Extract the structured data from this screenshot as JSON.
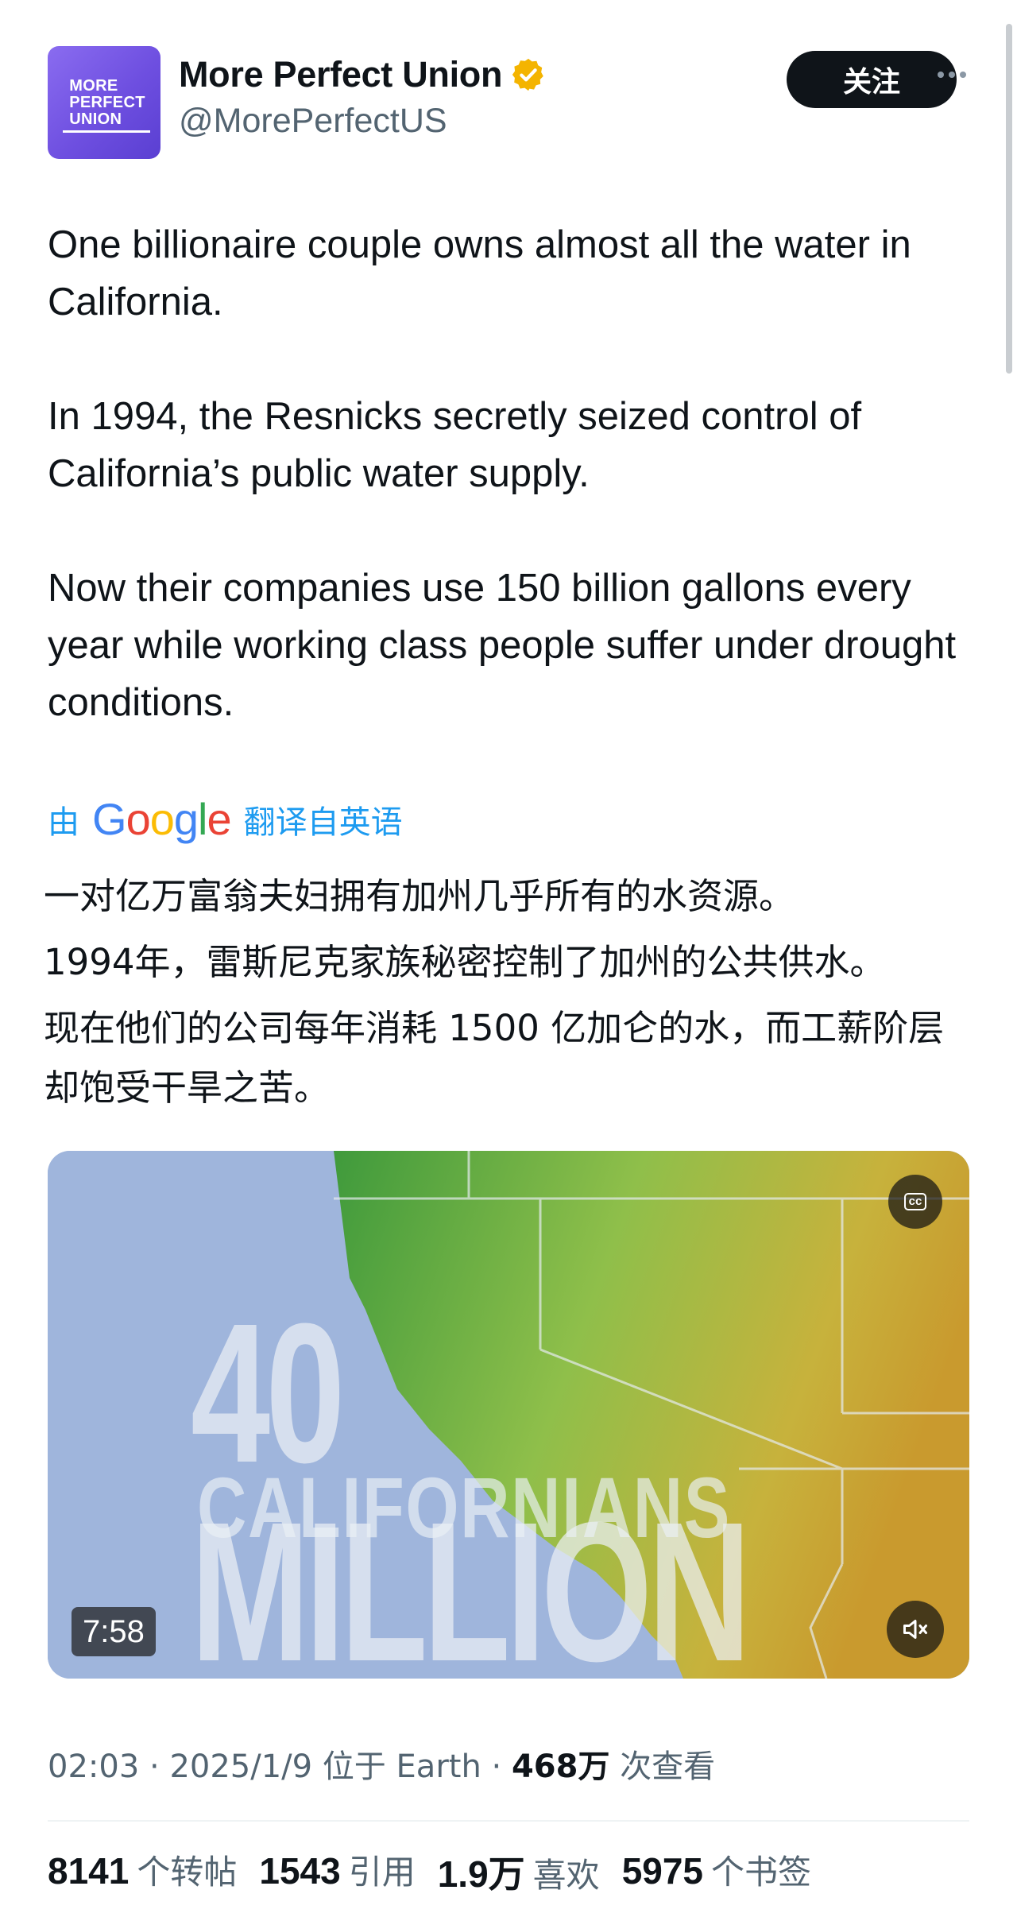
{
  "author": {
    "avatar_logo_lines": [
      "MORE",
      "PERFECT",
      "UNION"
    ],
    "display_name": "More Perfect Union",
    "handle": "@MorePerfectUS",
    "verified_icon": "verified-badge-gold"
  },
  "actions": {
    "follow_label": "关注",
    "more_icon": "more-horizontal-icon"
  },
  "tweet": {
    "paragraphs": [
      "One billionaire couple owns almost all the water in California.",
      "In 1994, the Resnicks secretly seized control of California’s public water supply.",
      "Now their companies use 150 billion gallons every year while working class people suffer under drought conditions."
    ]
  },
  "translation": {
    "prefix": "由",
    "provider": "Google",
    "suffix": "翻译自英语",
    "paragraphs": [
      "一对亿万富翁夫妇拥有加州几乎所有的水资源。",
      "1994年，雷斯尼克家族秘密控制了加州的公共供水。",
      "现在他们的公司每年消耗 1500 亿加仑的水，而工薪阶层却饱受干旱之苦。"
    ]
  },
  "video": {
    "overlay_title": "40 MILLION",
    "overlay_subtitle": "CALIFORNIANS",
    "duration": "7:58",
    "cc_label": "cc",
    "cc_icon": "closed-captions-icon",
    "mute_icon": "volume-muted-icon",
    "colors": {
      "ocean": "#9fb5dc",
      "land_green": "#6aa84f",
      "land_yellow": "#c9a63a"
    }
  },
  "meta": {
    "time": "02:03",
    "date": "2025/1/9",
    "location_prefix": "位于",
    "location": "Earth",
    "views": "468万",
    "views_label": "次查看"
  },
  "stats": {
    "reposts": "8141",
    "reposts_label": "个转帖",
    "quotes": "1543",
    "quotes_label": "引用",
    "likes": "1.9万",
    "likes_label": "喜欢",
    "bookmarks": "5975",
    "bookmarks_label": "个书签"
  },
  "colors": {
    "text": "#0f1419",
    "secondary": "#536471",
    "link": "#1d9bf0",
    "follow_bg": "#0f1419",
    "avatar_bg": "#6e4fe0",
    "verified": "#f4b400"
  }
}
